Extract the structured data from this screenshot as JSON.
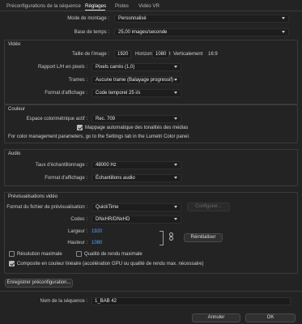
{
  "tabs": [
    {
      "label": "Préconfigurations de la séquence"
    },
    {
      "label": "Réglages"
    },
    {
      "label": "Pistes"
    },
    {
      "label": "Vidéo VR"
    }
  ],
  "general": {
    "editing_mode_label": "Mode de montage :",
    "editing_mode_value": "Personnalisé",
    "timebase_label": "Base de temps :",
    "timebase_value": "25,00  images/seconde"
  },
  "video": {
    "title": "Vidéo",
    "frame_size_label": "Taille de l'image :",
    "width": "1920",
    "horizontal_label": "Horizontalement",
    "height": "1080",
    "vertical_label": "Verticalement",
    "aspect": "16:9",
    "par_label": "Rapport L/H en pixels :",
    "par_value": "Pixels carrés (1,0)",
    "fields_label": "Trames :",
    "fields_value": "Aucune trame (Balayage progressif)",
    "display_format_label": "Format d'affichage :",
    "display_format_value": "Code temporel 25 i/s"
  },
  "color": {
    "title": "Couleur",
    "working_space_label": "Espace colorimétrique actif :",
    "working_space_value": "Rec. 709",
    "tone_mapping_label": "Mappage automatique des tonalités des médias",
    "note": "For color management parameters, go to the Settings tab in the Lumetri Color panel."
  },
  "audio": {
    "title": "Audio",
    "sample_rate_label": "Taux d'échantillonnage :",
    "sample_rate_value": "48000 Hz",
    "display_format_label": "Format d'affichage :",
    "display_format_value": "Échantillons audio"
  },
  "previews": {
    "title": "Prévisualisations vidéo",
    "file_format_label": "Format du fichier de prévisualisation :",
    "file_format_value": "QuickTime",
    "configure_label": "Configurer...",
    "codec_label": "Codec :",
    "codec_value": "DNxHR/DNxHD",
    "width_label": "Largeur :",
    "width_value": "1920",
    "height_label": "Hauteur :",
    "height_value": "1080",
    "reset_label": "Réinitialiser",
    "max_bit_depth_label": "Résolution maximale",
    "max_render_quality_label": "Qualité de rendu maximale",
    "linear_composite_label": "Composite en couleur linéaire (accélération GPU ou qualité de rendu max. nécessaire)"
  },
  "save_preset_label": "Enregistrer préconfiguration...",
  "sequence_name_label": "Nom de la séquence :",
  "sequence_name_value": "1_BAB 42",
  "footer": {
    "cancel_label": "Annuler",
    "ok_label": "OK"
  },
  "colors": {
    "background": "#232323",
    "accent_blue": "#5aa3ff"
  }
}
